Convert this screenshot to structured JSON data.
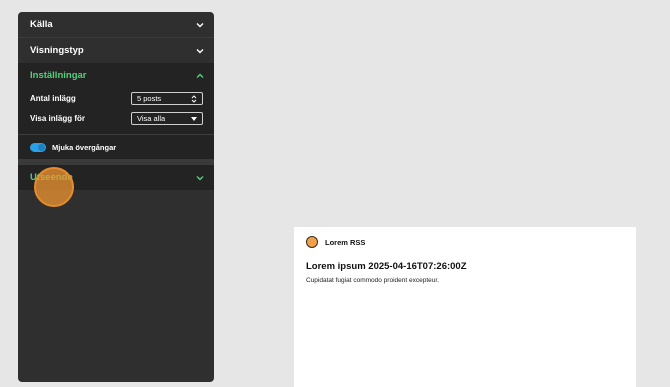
{
  "sidebar": {
    "sections": {
      "source": "Källa",
      "view_type": "Visningstyp",
      "settings": "Inställningar",
      "appearance": "Utseende"
    },
    "settings": {
      "post_count_label": "Antal inlägg",
      "post_count_value": "5 posts",
      "show_posts_for_label": "Visa inlägg för",
      "show_posts_for_value": "Visa alla",
      "smooth_transitions_label": "Mjuka övergångar",
      "smooth_transitions_on": true
    },
    "accent_color": "#4fd37a",
    "toggle_color": "#2aa0e6"
  },
  "preview": {
    "feed_name": "Lorem RSS",
    "post_title": "Lorem ipsum 2025-04-16T07:26:00Z",
    "post_excerpt": "Cupidatat fugiat commodo proident excepteur."
  }
}
